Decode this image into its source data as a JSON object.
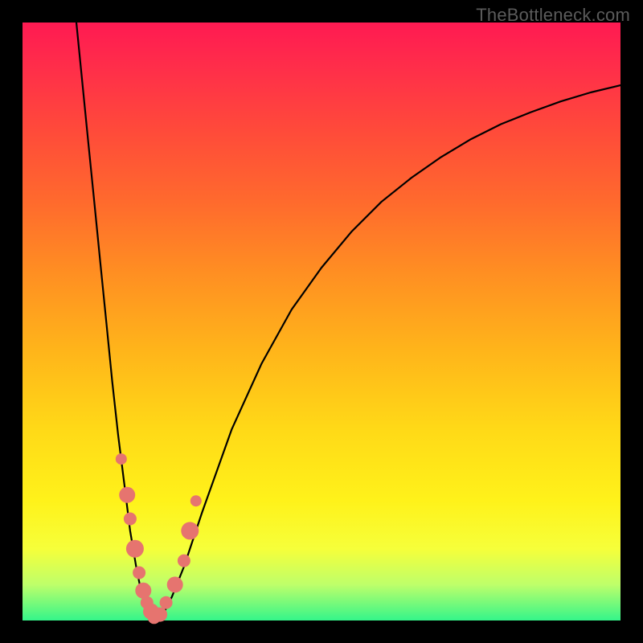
{
  "watermark": "TheBottleneck.com",
  "colors": {
    "frame": "#000000",
    "curve_stroke": "#000000",
    "marker_fill": "#e6746f",
    "marker_stroke": "#b54c47"
  },
  "chart_data": {
    "type": "line",
    "title": "",
    "xlabel": "",
    "ylabel": "",
    "xlim": [
      0,
      100
    ],
    "ylim": [
      0,
      100
    ],
    "grid": false,
    "legend": false,
    "x": [
      9,
      10,
      11,
      12,
      13,
      14,
      15,
      16,
      17,
      18,
      19,
      20,
      21,
      22,
      23.5,
      25,
      27,
      30,
      35,
      40,
      45,
      50,
      55,
      60,
      65,
      70,
      75,
      80,
      85,
      90,
      95,
      100
    ],
    "values": [
      100,
      90,
      80,
      70,
      60,
      50,
      40,
      31,
      23,
      15,
      9,
      4,
      1,
      0,
      1,
      4,
      9,
      18,
      32,
      43,
      52,
      59,
      65,
      70,
      74,
      77.5,
      80.5,
      83,
      85,
      86.8,
      88.3,
      89.5
    ],
    "markers": {
      "x": [
        16.5,
        17.5,
        18.0,
        18.8,
        19.5,
        20.2,
        20.8,
        21.5,
        22.0,
        23.0,
        24.0,
        25.5,
        27.0,
        28.0,
        29.0
      ],
      "y": [
        27,
        21,
        17,
        12,
        8,
        5,
        3,
        1.5,
        0.5,
        1,
        3,
        6,
        10,
        15,
        20
      ],
      "r": [
        7,
        10,
        8,
        11,
        8,
        10,
        8,
        10,
        8,
        9,
        8,
        10,
        8,
        11,
        7
      ]
    }
  }
}
